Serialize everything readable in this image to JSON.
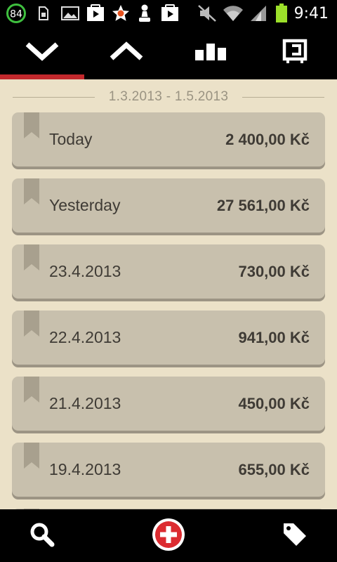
{
  "status_bar": {
    "battery_badge": "84",
    "time": "9:41",
    "icons": [
      "battery-84-icon",
      "sim-icon",
      "image-icon",
      "play-store-icon",
      "star-icon",
      "chess-pawn-icon",
      "play-store-icon",
      "mute-icon",
      "wifi-icon",
      "signal-icon",
      "battery-icon"
    ]
  },
  "tabs": [
    {
      "name": "expenses",
      "icon": "chevron-down-icon",
      "active": true
    },
    {
      "name": "income",
      "icon": "chevron-up-icon",
      "active": false
    },
    {
      "name": "stats",
      "icon": "bar-chart-icon",
      "active": false
    },
    {
      "name": "budget",
      "icon": "box-icon",
      "active": false
    }
  ],
  "date_range": "1.3.2013 - 1.5.2013",
  "entries": [
    {
      "label": "Today",
      "amount": "2 400,00 Kč"
    },
    {
      "label": "Yesterday",
      "amount": "27 561,00 Kč"
    },
    {
      "label": "23.4.2013",
      "amount": "730,00 Kč"
    },
    {
      "label": "22.4.2013",
      "amount": "941,00 Kč"
    },
    {
      "label": "21.4.2013",
      "amount": "450,00 Kč"
    },
    {
      "label": "19.4.2013",
      "amount": "655,00 Kč"
    }
  ],
  "bottom_bar": {
    "search": "search-icon",
    "add": "add-icon",
    "tags": "tag-icon"
  },
  "colors": {
    "accent": "#c2282c",
    "background": "#ebe1c8",
    "card": "#c8c0ad",
    "text": "#3f3b35"
  }
}
